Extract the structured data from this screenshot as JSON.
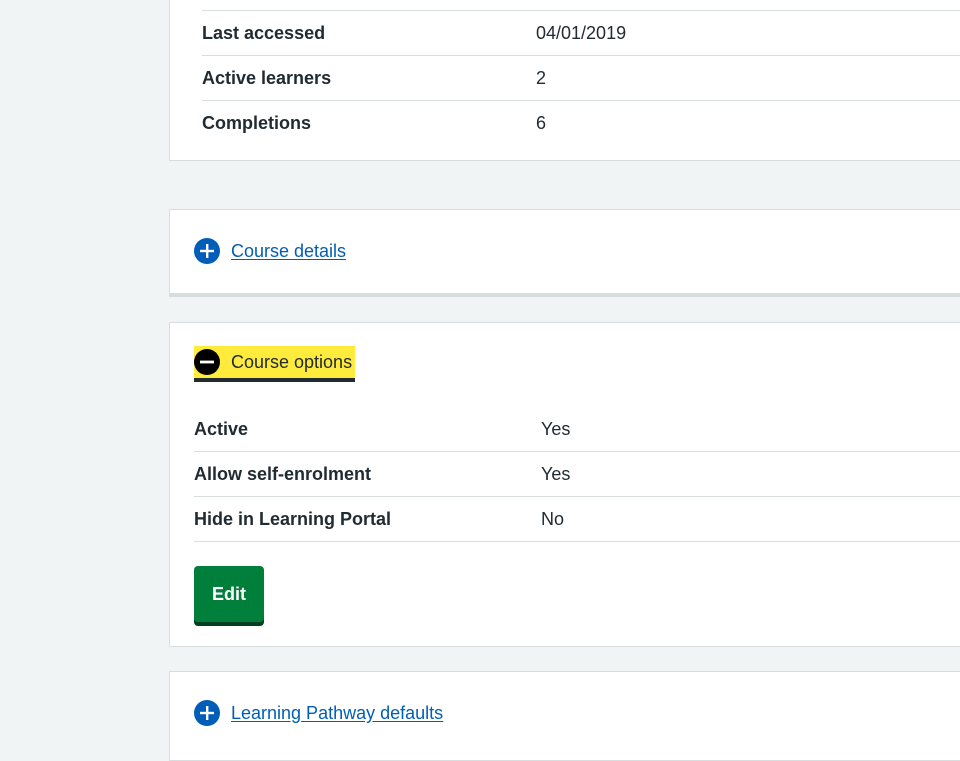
{
  "summary": {
    "rows": [
      {
        "key": "Last accessed",
        "value": "04/01/2019"
      },
      {
        "key": "Active learners",
        "value": "2"
      },
      {
        "key": "Completions",
        "value": "6"
      }
    ]
  },
  "course_details": {
    "label": "Course details",
    "icon": "plus-icon",
    "expanded": false
  },
  "course_options": {
    "label": "Course options",
    "icon": "minus-icon",
    "expanded": true,
    "rows": [
      {
        "key": "Active",
        "value": "Yes"
      },
      {
        "key": "Allow self-enrolment",
        "value": "Yes"
      },
      {
        "key": "Hide in Learning Portal",
        "value": "No"
      }
    ],
    "edit_label": "Edit"
  },
  "learning_pathway": {
    "label": "Learning Pathway defaults",
    "icon": "plus-icon",
    "expanded": false
  },
  "colors": {
    "link": "#005eb8",
    "focus": "#ffeb3b",
    "button": "#007f3b",
    "background": "#f0f4f5"
  }
}
